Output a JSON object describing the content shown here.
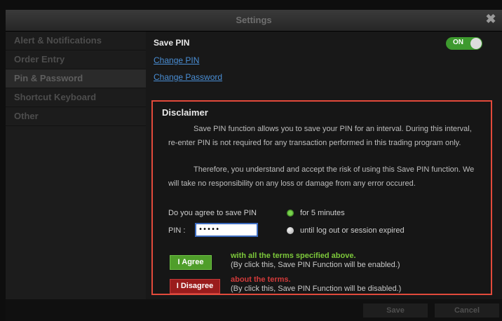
{
  "window": {
    "title": "Settings",
    "close_glyph": "✖"
  },
  "sidebar": {
    "items": [
      {
        "label": "Alert & Notifications"
      },
      {
        "label": "Order Entry"
      },
      {
        "label": "Pin & Password",
        "active": true
      },
      {
        "label": "Shortcut Keyboard"
      },
      {
        "label": "Other"
      }
    ]
  },
  "main": {
    "save_pin_label": "Save PIN",
    "toggle": {
      "state": "ON",
      "color": "#3d9a2e"
    },
    "change_pin_link": "Change PIN",
    "change_password_link": "Change Password"
  },
  "disclaimer": {
    "title": "Disclaimer",
    "para1": "Save PIN function allows you to save your PIN for an interval. During this interval, re-enter PIN is not required for any transaction performed in this trading program only.",
    "para2": "Therefore, you understand and accept the risk of using this Save PIN function. We will take no responsibility on any loss or damage from any error occured.",
    "question": "Do you agree to save PIN",
    "option1": "for 5 minutes",
    "option2": "until log out or session expired",
    "selected_option": "for 5 minutes",
    "pin_label": "PIN :",
    "pin_value": "•••••",
    "agree_button": "I Agree",
    "agree_note": "with all the terms specified above.",
    "agree_sub": "(By click this, Save PIN Function will be enabled.)",
    "disagree_button": "I Disagree",
    "disagree_note": "about the terms.",
    "disagree_sub": "(By click this, Save PIN Function will be disabled.)",
    "agree_color": "#7cc83a",
    "disagree_color": "#d23a3a",
    "highlight_border_color": "#e24a3b"
  },
  "footer": {
    "save_button": "Save",
    "cancel_button": "Cancel"
  }
}
